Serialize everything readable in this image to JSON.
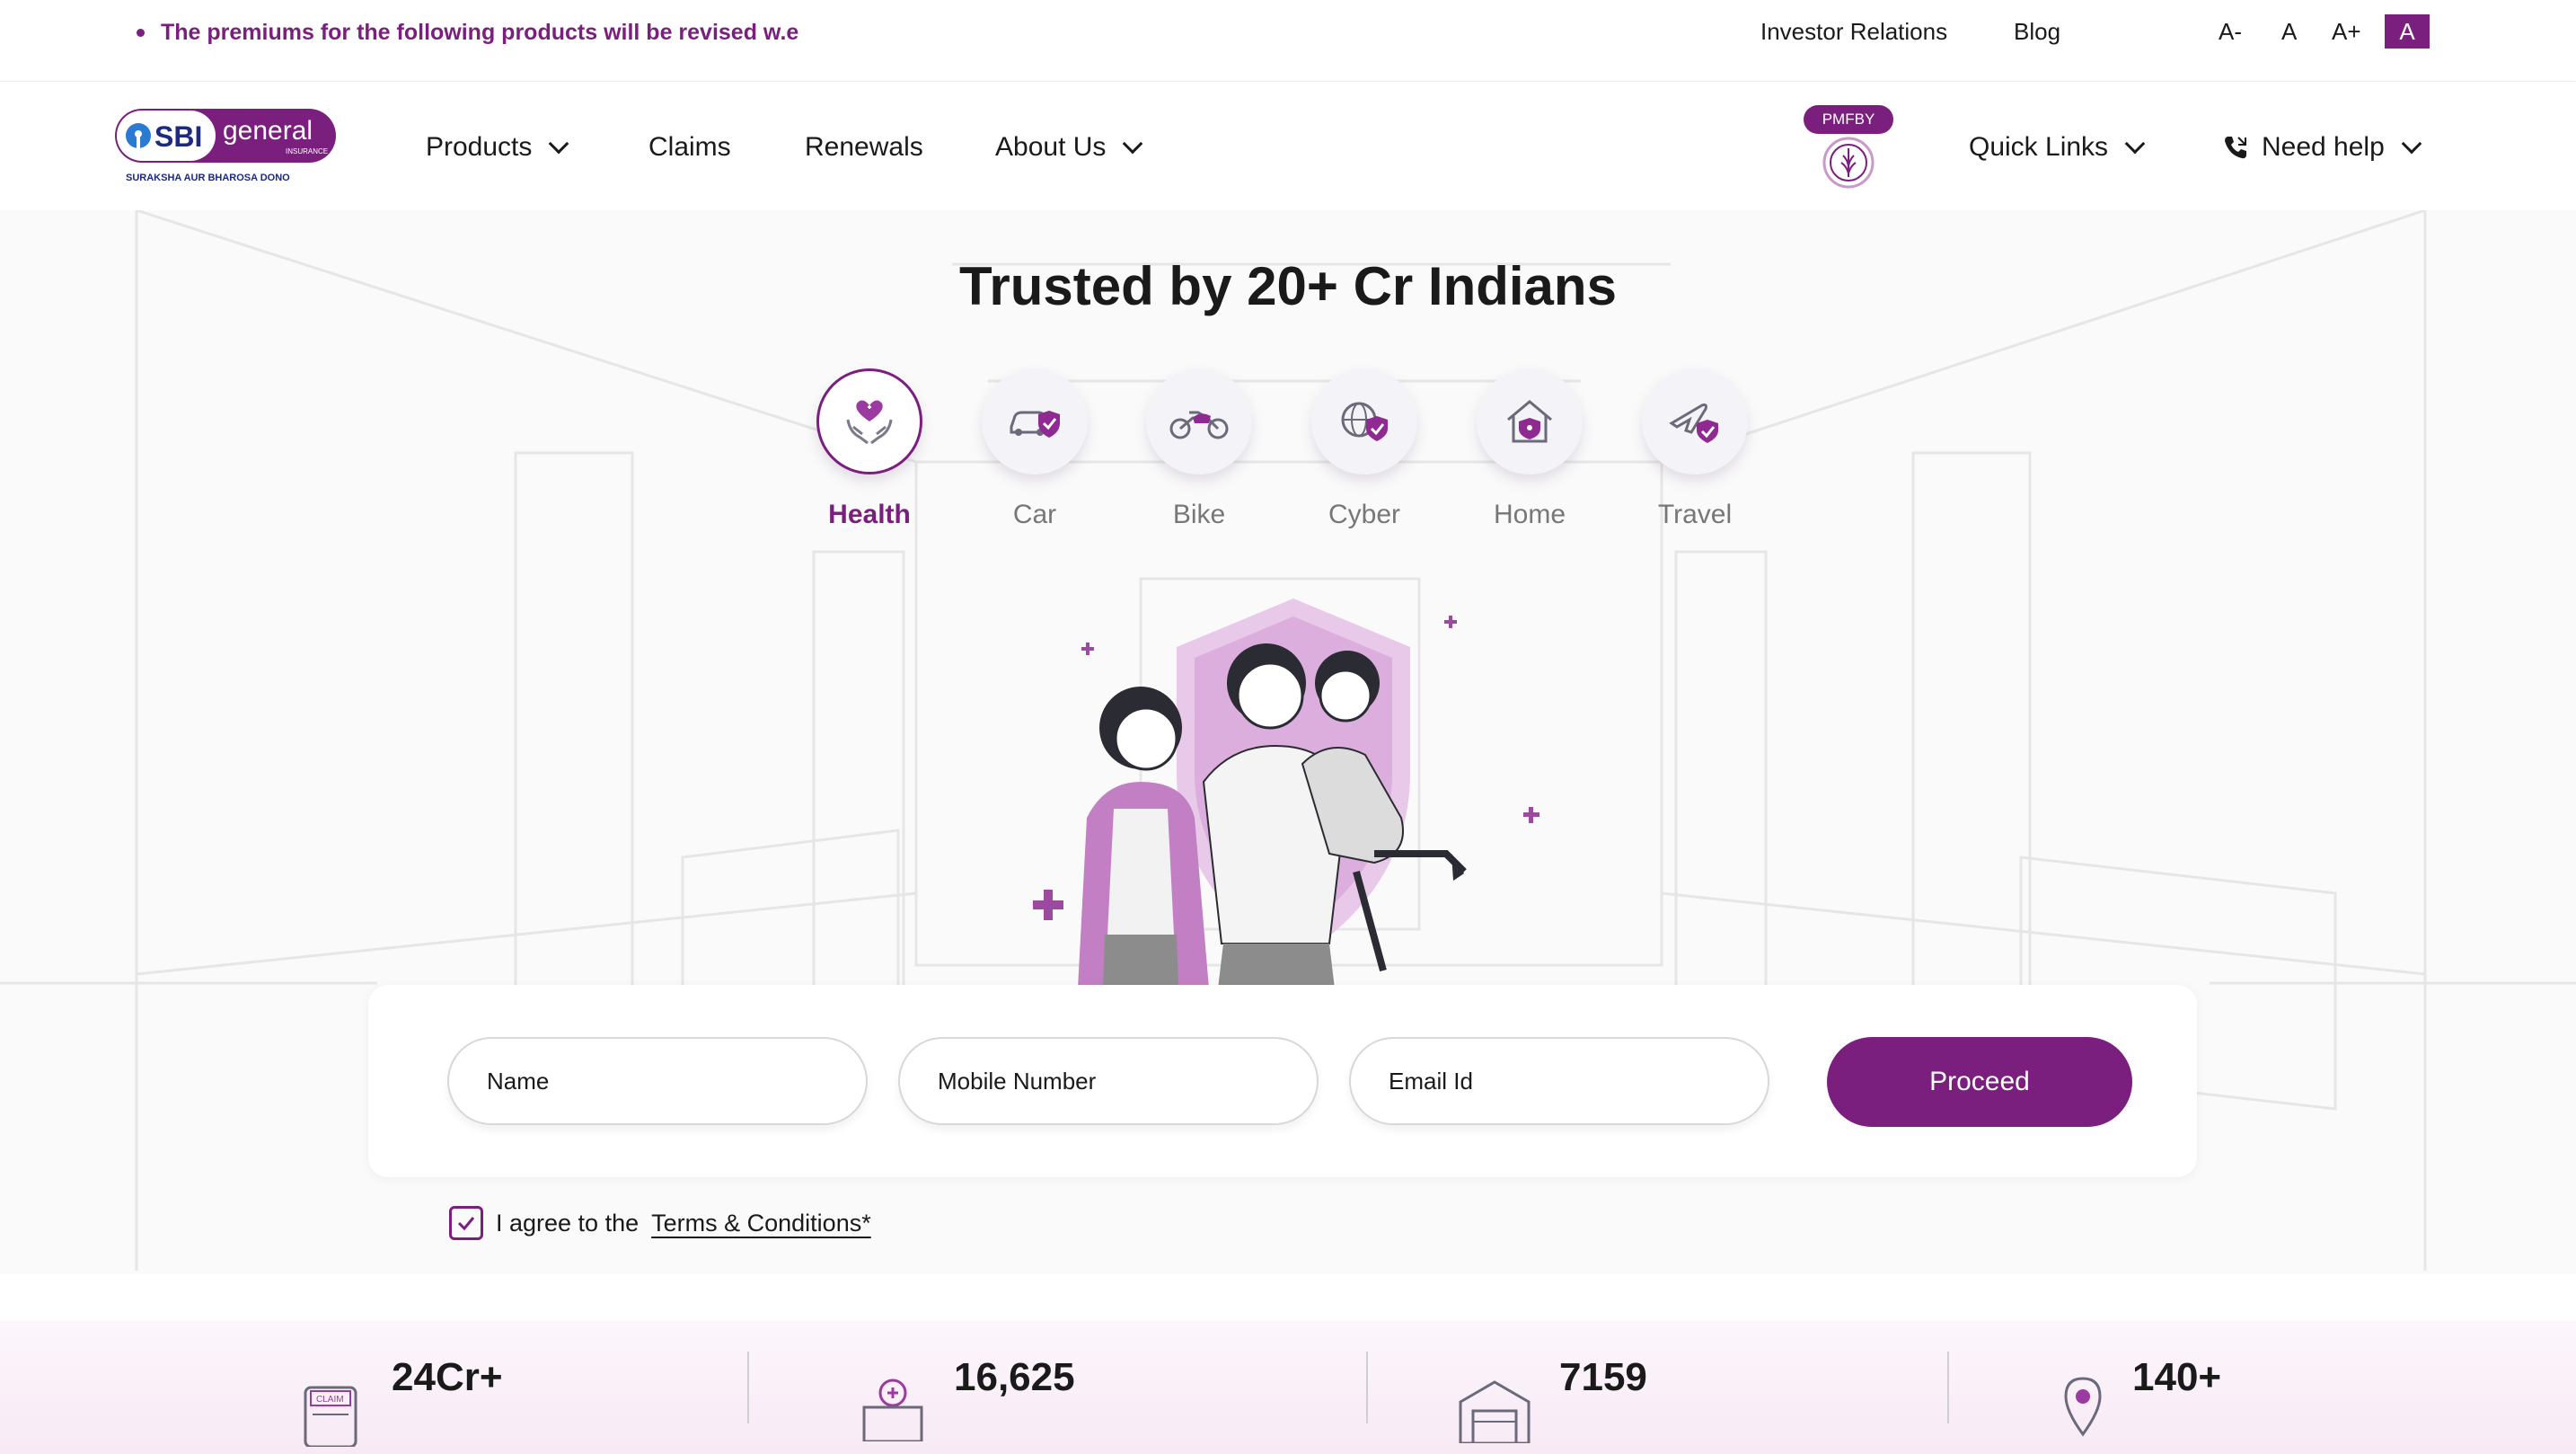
{
  "announcement": {
    "text": "The premiums for the following products will be revised w.e"
  },
  "top_links": {
    "investor": "Investor Relations",
    "blog": "Blog"
  },
  "font_controls": {
    "decrease": "A-",
    "normal": "A",
    "increase": "A+",
    "active": "A"
  },
  "logo": {
    "brand": "SBI",
    "word": "general",
    "sub": "INSURANCE",
    "tagline": "SURAKSHA AUR BHAROSA DONO"
  },
  "nav": {
    "products": "Products",
    "claims": "Claims",
    "renewals": "Renewals",
    "about": "About Us",
    "pmfby": "PMFBY",
    "quick_links": "Quick Links",
    "need_help": "Need help"
  },
  "hero": {
    "title": "Trusted by 20+ Cr Indians",
    "categories": [
      {
        "label": "Health",
        "icon": "health-hands-heart-icon",
        "active": true
      },
      {
        "label": "Car",
        "icon": "car-shield-icon",
        "active": false
      },
      {
        "label": "Bike",
        "icon": "bike-icon",
        "active": false
      },
      {
        "label": "Cyber",
        "icon": "globe-shield-icon",
        "active": false
      },
      {
        "label": "Home",
        "icon": "home-shield-icon",
        "active": false
      },
      {
        "label": "Travel",
        "icon": "plane-shield-icon",
        "active": false
      }
    ]
  },
  "form": {
    "name_placeholder": "Name",
    "mobile_placeholder": "Mobile Number",
    "email_placeholder": "Email Id",
    "proceed": "Proceed",
    "agree_text": "I agree to the",
    "terms": "Terms & Conditions*"
  },
  "stats": [
    {
      "value": "24Cr+",
      "icon": "claim-document-icon"
    },
    {
      "value": "16,625",
      "icon": "hospital-icon"
    },
    {
      "value": "7159",
      "icon": "garage-icon"
    },
    {
      "value": "140+",
      "icon": "location-pin-icon"
    }
  ],
  "colors": {
    "brand": "#7a1f7e",
    "accent_light": "#e9c9e9",
    "text": "#1a1a1a"
  }
}
